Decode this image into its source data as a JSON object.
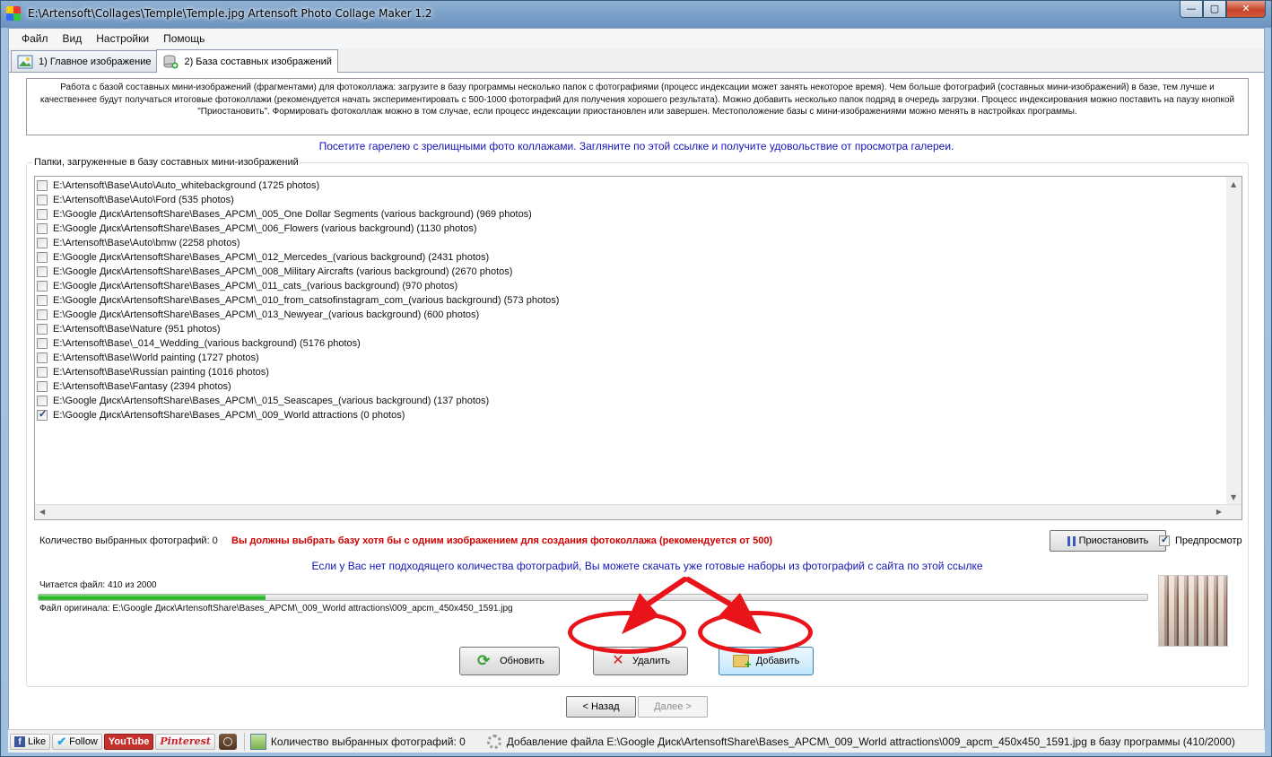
{
  "window": {
    "title": "E:\\Artensoft\\Collages\\Temple\\Temple.jpg Artensoft Photo Collage Maker 1.2",
    "min_glyph": "—",
    "max_glyph": "▢",
    "close_glyph": "✕"
  },
  "menu": [
    "Файл",
    "Вид",
    "Настройки",
    "Помощь"
  ],
  "tabs": [
    {
      "label": "1) Главное изображение",
      "icon": "image-icon"
    },
    {
      "label": "2) База составных изображений",
      "icon": "database-icon"
    }
  ],
  "info_text": "Работа с базой составных мини-изображений (фрагментами) для фотоколлажа: загрузите в базу программы несколько папок с фотографиями (процесс индексации может занять некоторое время). Чем больше фотографий (составных мини-изображений) в базе, тем лучше и качественнее будут получаться итоговые фотоколлажи (рекомендуется начать экспериментировать с 500-1000 фотографий для получения хорошего результата). Можно добавить несколько папок подряд в очередь загрузки. Процесс индексирования можно поставить на паузу кнопкой \"Приостановить\". Формировать фотоколлаж можно в том случае, если процесс индексации приостановлен или завершен. Местоположение базы с мини-изображениями можно менять в настройках программы.",
  "gallery_link": "Посетите гарелею с зрелищными фото коллажами. Загляните по этой ссылке и получите удовольствие от просмотра галереи.",
  "folders_legend": "Папки, загруженные в базу составных мини-изображений",
  "folders": [
    {
      "path": "E:\\Artensoft\\Base\\Auto\\Auto_whitebackground (1725 photos)",
      "checked": false
    },
    {
      "path": "E:\\Artensoft\\Base\\Auto\\Ford (535 photos)",
      "checked": false
    },
    {
      "path": "E:\\Google Диск\\ArtensoftShare\\Bases_APCM\\_005_One Dollar Segments (various background) (969 photos)",
      "checked": false
    },
    {
      "path": "E:\\Google Диск\\ArtensoftShare\\Bases_APCM\\_006_Flowers (various background) (1130 photos)",
      "checked": false
    },
    {
      "path": "E:\\Artensoft\\Base\\Auto\\bmw (2258 photos)",
      "checked": false
    },
    {
      "path": "E:\\Google Диск\\ArtensoftShare\\Bases_APCM\\_012_Mercedes_(various background) (2431 photos)",
      "checked": false
    },
    {
      "path": "E:\\Google Диск\\ArtensoftShare\\Bases_APCM\\_008_Military Aircrafts (various background) (2670 photos)",
      "checked": false
    },
    {
      "path": "E:\\Google Диск\\ArtensoftShare\\Bases_APCM\\_011_cats_(various background) (970 photos)",
      "checked": false
    },
    {
      "path": "E:\\Google Диск\\ArtensoftShare\\Bases_APCM\\_010_from_catsofinstagram_com_(various background) (573 photos)",
      "checked": false
    },
    {
      "path": "E:\\Google Диск\\ArtensoftShare\\Bases_APCM\\_013_Newyear_(various background) (600 photos)",
      "checked": false
    },
    {
      "path": "E:\\Artensoft\\Base\\Nature (951 photos)",
      "checked": false
    },
    {
      "path": "E:\\Artensoft\\Base\\_014_Wedding_(various background) (5176 photos)",
      "checked": false
    },
    {
      "path": "E:\\Artensoft\\Base\\World painting (1727 photos)",
      "checked": false
    },
    {
      "path": "E:\\Artensoft\\Base\\Russian painting (1016 photos)",
      "checked": false
    },
    {
      "path": "E:\\Artensoft\\Base\\Fantasy (2394 photos)",
      "checked": false
    },
    {
      "path": "E:\\Google Диск\\ArtensoftShare\\Bases_APCM\\_015_Seascapes_(various background) (137 photos)",
      "checked": false
    },
    {
      "path": "E:\\Google Диск\\ArtensoftShare\\Bases_APCM\\_009_World attractions (0 photos)",
      "checked": true
    }
  ],
  "selected_count_label": "Количество выбранных фотографий: 0",
  "warning": "Вы должны выбрать базу хотя бы с одним изображением для создания фотоколлажа (рекомендуется от 500)",
  "pause_button": "Приостановить",
  "preview_checkbox": {
    "label": "Предпросмотр",
    "checked": true
  },
  "download_link": "Если у Вас нет подходящего количества фотографий, Вы можете скачать уже готовые наборы из фотографий с сайта по этой ссылке",
  "reading_status": "Читается файл: 410  из  2000",
  "progress_fraction": 0.205,
  "original_file": "Файл оригинала:  E:\\Google Диск\\ArtensoftShare\\Bases_APCM\\_009_World attractions\\009_apcm_450x450_1591.jpg",
  "buttons": {
    "refresh": "Обновить",
    "delete": "Удалить",
    "add": "Добавить"
  },
  "nav": {
    "back": "< Назад",
    "next": "Далее >"
  },
  "statusbar": {
    "social": [
      "Like",
      "Follow",
      "YouTube",
      "Pinterest"
    ],
    "selected_count": "Количество выбранных фотографий: 0",
    "adding_status": "Добавление файла E:\\Google Диск\\ArtensoftShare\\Bases_APCM\\_009_World attractions\\009_apcm_450x450_1591.jpg в базу программы (410/2000)"
  },
  "colors": {
    "accent_link": "#1515b5",
    "warning": "#d00000",
    "progress": "#20b020",
    "annotation_red": "#e8141a"
  }
}
